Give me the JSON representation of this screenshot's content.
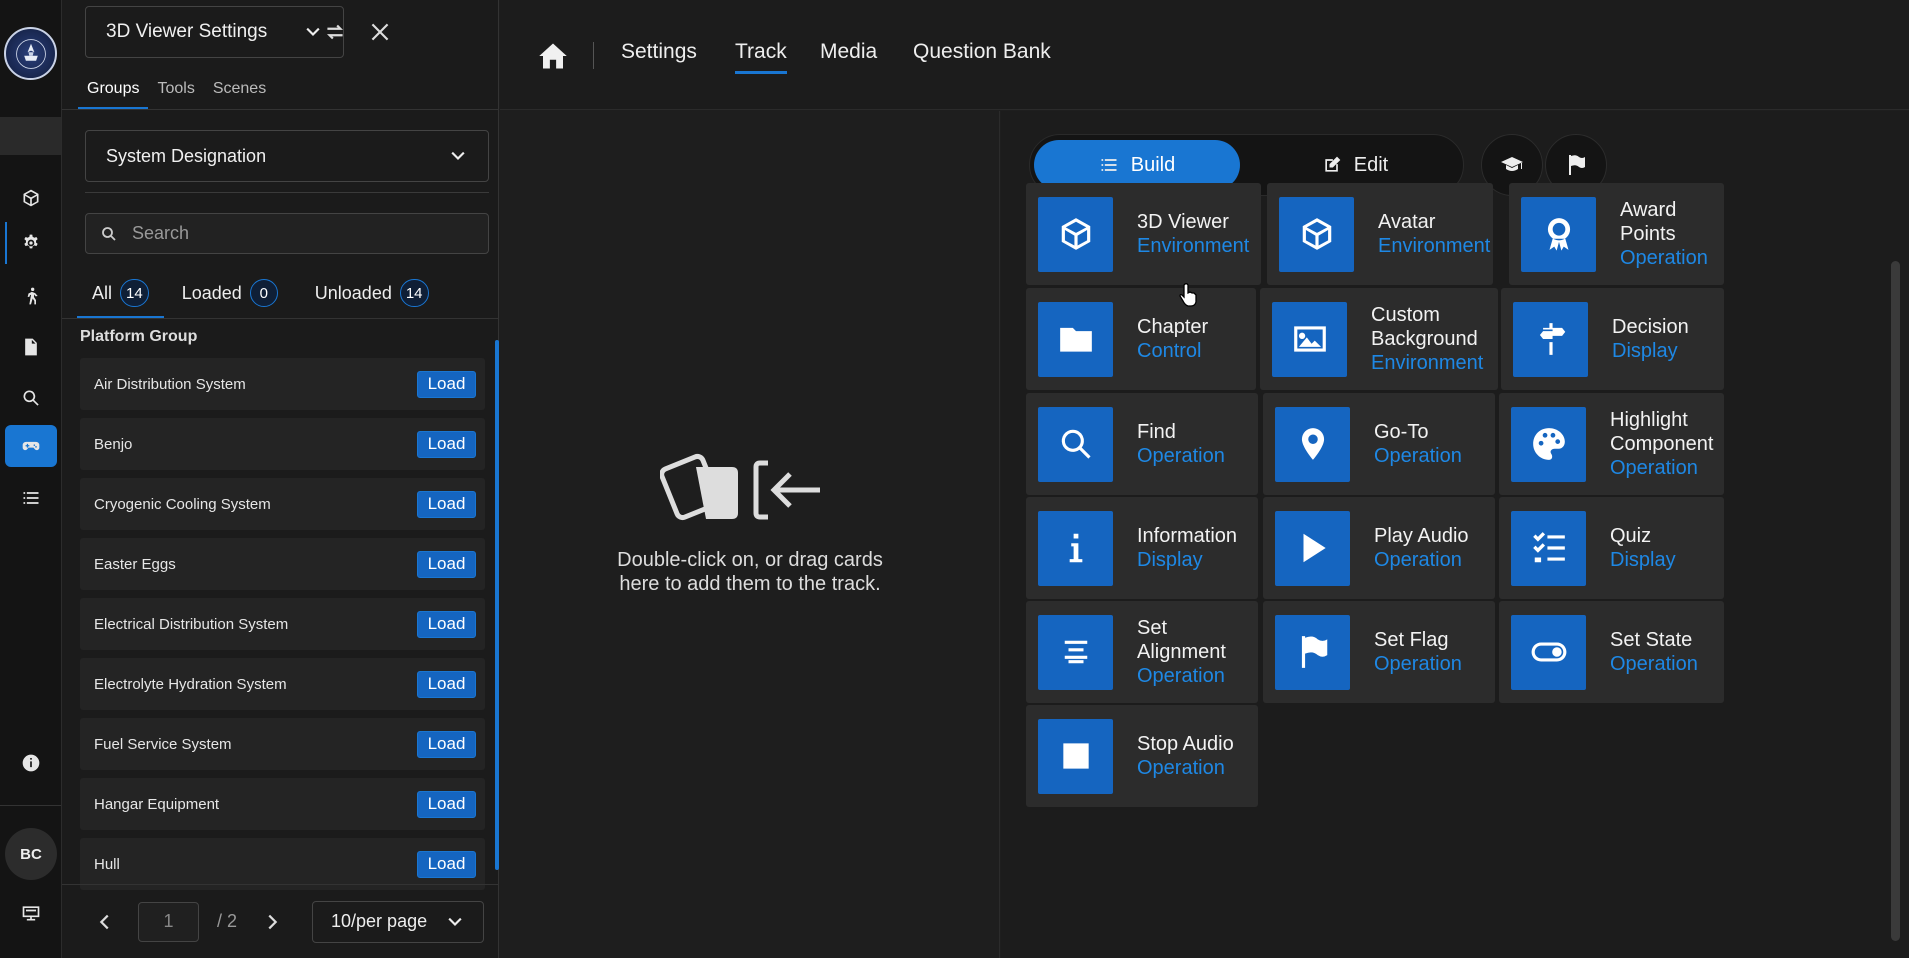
{
  "panel": {
    "viewer_select": "3D Viewer Settings",
    "tabs": [
      "Groups",
      "Tools",
      "Scenes"
    ],
    "group_select": "System Designation",
    "search_placeholder": "Search",
    "filters": [
      {
        "label": "All",
        "count": "14"
      },
      {
        "label": "Loaded",
        "count": "0"
      },
      {
        "label": "Unloaded",
        "count": "14"
      }
    ],
    "section_title": "Platform Group",
    "load_label": "Load",
    "items": [
      "Air Distribution System",
      "Benjo",
      "Cryogenic Cooling System",
      "Easter Eggs",
      "Electrical Distribution System",
      "Electrolyte Hydration System",
      "Fuel Service System",
      "Hangar Equipment",
      "Hull"
    ],
    "pagination": {
      "page": "1",
      "total": "/ 2",
      "per_page": "10/per page"
    }
  },
  "rail": {
    "avatar": "BC"
  },
  "nav": {
    "items": [
      "Settings",
      "Track",
      "Media",
      "Question Bank"
    ],
    "active": "Track"
  },
  "track": {
    "drop_text": "Double-click on, or drag cards here to add them to the track."
  },
  "toolbar": {
    "build_label": "Build",
    "edit_label": "Edit"
  },
  "cards": [
    {
      "title": "3D Viewer",
      "category": "Environment",
      "icon": "cube-icon"
    },
    {
      "title": "Avatar",
      "category": "Environment",
      "icon": "cube-icon"
    },
    {
      "title": "Award Points",
      "category": "Operation",
      "icon": "award-icon"
    },
    {
      "title": "Chapter",
      "category": "Control",
      "icon": "folder-icon"
    },
    {
      "title": "Custom Background",
      "category": "Environment",
      "icon": "image-icon"
    },
    {
      "title": "Decision",
      "category": "Display",
      "icon": "signpost-icon"
    },
    {
      "title": "Find",
      "category": "Operation",
      "icon": "search-icon"
    },
    {
      "title": "Go-To",
      "category": "Operation",
      "icon": "map-pin-icon"
    },
    {
      "title": "Highlight Component",
      "category": "Operation",
      "icon": "palette-icon"
    },
    {
      "title": "Information",
      "category": "Display",
      "icon": "info-icon"
    },
    {
      "title": "Play Audio",
      "category": "Operation",
      "icon": "play-icon"
    },
    {
      "title": "Quiz",
      "category": "Display",
      "icon": "checklist-icon"
    },
    {
      "title": "Set Alignment",
      "category": "Operation",
      "icon": "align-center-icon"
    },
    {
      "title": "Set Flag",
      "category": "Operation",
      "icon": "flag-icon"
    },
    {
      "title": "Set State",
      "category": "Operation",
      "icon": "toggle-icon"
    },
    {
      "title": "Stop Audio",
      "category": "Operation",
      "icon": "stop-icon"
    }
  ],
  "colors": {
    "accent": "#1976d2",
    "card_icon_bg": "#1565c0",
    "category_text": "#1e88e5"
  }
}
